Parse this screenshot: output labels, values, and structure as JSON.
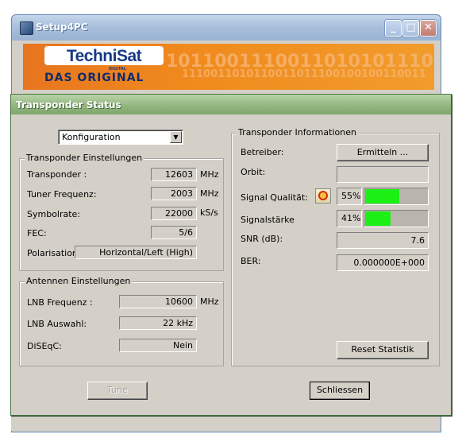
{
  "back_window": {
    "title": "Setup4PC",
    "banner": {
      "logo_text": "TechniSat",
      "logo_subtext": "DIGITAL",
      "slogan": "DAS ORIGINAL",
      "binary_line1": "1011001110011010101110",
      "binary_line2": "1110011010110011011100100100110011"
    }
  },
  "dialog": {
    "title": "Transponder Status",
    "config_select": {
      "selected": "Konfiguration"
    },
    "transponder_settings": {
      "legend": "Transponder Einstellungen",
      "rows": [
        {
          "label": "Transponder :",
          "value": "12603",
          "unit": "MHz"
        },
        {
          "label": "Tuner Frequenz:",
          "value": "2003",
          "unit": "MHz"
        },
        {
          "label": "Symbolrate:",
          "value": "22000",
          "unit": "kS/s"
        },
        {
          "label": "FEC:",
          "value": "5/6",
          "unit": ""
        }
      ],
      "polarisation": {
        "label": "Polarisation",
        "value": "Horizontal/Left (High)"
      }
    },
    "antenna_settings": {
      "legend": "Antennen Einstellungen",
      "rows": [
        {
          "label": "LNB Frequenz :",
          "value": "10600",
          "unit": "MHz"
        },
        {
          "label": "LNB Auswahl:",
          "value": "22 kHz",
          "unit": ""
        },
        {
          "label": "DiSEqC:",
          "value": "Nein",
          "unit": ""
        }
      ]
    },
    "transponder_info": {
      "legend": "Transponder Informationen",
      "operator_label": "Betreiber:",
      "operator_button": "Ermitteln ...",
      "orbit_label": "Orbit:",
      "orbit_value": "",
      "signal_quality_label": "Signal Qualität:",
      "signal_quality_percent": "55%",
      "signal_quality_value": 55,
      "signal_strength_label": "Signalstärke",
      "signal_strength_percent": "41%",
      "signal_strength_value": 41,
      "snr_label": "SNR (dB):",
      "snr_value": "7.6",
      "ber_label": "BER:",
      "ber_value": "0.000000E+000",
      "reset_button": "Reset Statistik"
    },
    "tune_button": "Tune",
    "close_button": "Schliessen"
  },
  "colors": {
    "dialog_title_green": "#8db27a",
    "back_title_blue": "#a9c0dc",
    "banner_orange": "#f08a1d",
    "bar_fill_green": "#1cf015"
  }
}
